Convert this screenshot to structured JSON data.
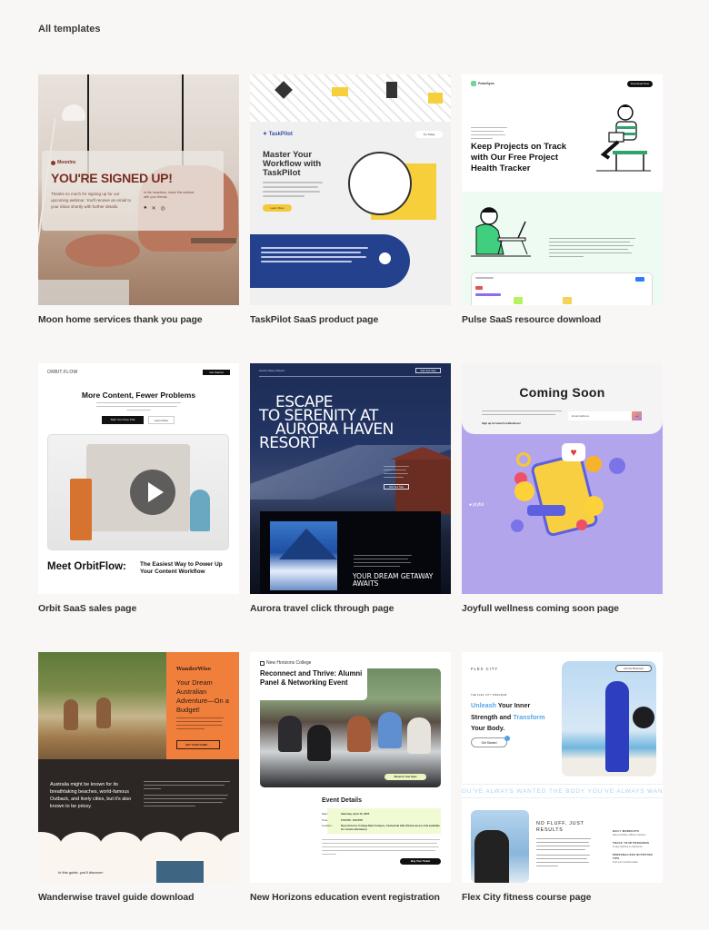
{
  "page": {
    "heading": "All templates"
  },
  "templates": [
    {
      "caption": "Moon home services thank you page",
      "preview": {
        "brand": "MoonInc",
        "headline": "YOU'RE SIGNED UP!",
        "body": "Thanks so much for signing up for our upcoming webinar. You'll receive an email to your inbox shortly with further details.",
        "share_text": "In the meantime, share this webinar with your friends.",
        "social_icons": [
          "facebook-icon",
          "x-icon",
          "instagram-icon"
        ],
        "accent_color": "#7a2e22"
      }
    },
    {
      "caption": "TaskPilot SaaS product page",
      "preview": {
        "brand": "TaskPilot",
        "nav_button": "Try Today",
        "headline": "Master Your Workflow with TaskPilot",
        "cta": "Learn More",
        "accent_color": "#f7cf3b",
        "band_color": "#24418e"
      }
    },
    {
      "caption": "Pulse SaaS resource download",
      "preview": {
        "brand": "PulseSync",
        "nav_button": "Download Now",
        "headline": "Keep Projects on Track with Our Free Project Health Tracker",
        "accent_color": "#6fd39b"
      }
    },
    {
      "caption": "Orbit SaaS sales page",
      "preview": {
        "brand": "ORBIT.FLOW",
        "nav_button": "Get Started",
        "headline": "More Content, Fewer Problems",
        "primary_cta": "Start Your Free Trial",
        "secondary_cta": "Learn More",
        "section_title": "Meet OrbitFlow:",
        "section_subtitle": "The Easiest Way to Power Up Your Content Workflow",
        "accent_color": "#d6742f"
      }
    },
    {
      "caption": "Aurora travel click through page",
      "preview": {
        "brand": "Aurora Haven Resort",
        "nav_button": "Visit Your Stay",
        "nav_button_note": "label is a best reading of blurred text",
        "headline_lines": [
          "ESCAPE",
          "TO SERENITY AT",
          "AURORA HAVEN",
          "RESORT"
        ],
        "secondary_headline": "YOUR DREAM GETAWAY AWAITS",
        "accent_color": "#1c2c55"
      }
    },
    {
      "caption": "Joyfull wellness coming soon page",
      "preview": {
        "brand": "joyful",
        "headline": "Coming Soon",
        "description": "An innovative new app that will improve your focus, reduce your stress, and help you live more joyfully.",
        "signup_label": "Sign up for launch notifications!",
        "email_placeholder": "Email address",
        "submit_icon": "arrow-right-icon",
        "accent_color": "#b3a5ec"
      }
    },
    {
      "caption": "Wanderwise travel guide download",
      "preview": {
        "brand": "WanderWise",
        "brand_note": "wordmark is script-styled; name inferred from caption",
        "headline": "Your Dream Australian Adventure—On a Budget!",
        "cta": "GET YOUR GUIDE →",
        "intro": "Australia might be known for its breathtaking beaches, world-famous Outback, and lively cities, but it's also known to be pricey.",
        "list_heading": "In this guide, you'll discover:",
        "accent_color": "#f07f3c"
      }
    },
    {
      "caption": "New Horizons education event registration",
      "preview": {
        "brand": "New Horizons College",
        "headline": "Reconnect and Thrive: Alumni Panel & Networking Event",
        "hero_cta": "Reserve Your Spot",
        "details_title": "Event Details",
        "details": [
          {
            "label": "Date:",
            "value": "Saturday, April 15, 2025"
          },
          {
            "label": "Time:",
            "value": "5:00 PM - 8:00 PM"
          },
          {
            "label": "Location:",
            "value": "New Horizons College Main Campus, Centennial Hall (Virtual access link available for remote attendees)"
          }
        ],
        "cta": "Buy Your Ticket",
        "accent_color": "#f0fbd4"
      }
    },
    {
      "caption": "Flex City fitness course page",
      "preview": {
        "brand": "FLEX CITY",
        "nav_button": "Join the Movement",
        "eyebrow": "THE FLEX CITY PROGRAM",
        "headline_parts": [
          {
            "text": "Unleash",
            "highlight": true
          },
          {
            "text": " Your Inner Strength and ",
            "highlight": false
          },
          {
            "text": "Transform",
            "highlight": true
          },
          {
            "text": " Your Body.",
            "highlight": false
          }
        ],
        "cta": "Get Started",
        "marquee": "OU'VE ALWAYS WANTED     THE BODY YOU'VE ALWAYS WANTED",
        "section_title": "NO FLUFF, JUST RESULTS",
        "features": [
          {
            "title": "DAILY WORKOUTS",
            "text": "Easy-to-follow, efficient routines"
          },
          {
            "title": "TRACK YOUR PROGRESS",
            "text": "In-app tracking & milestones"
          },
          {
            "title": "PERSONALIZED NUTRITION TIPS",
            "text": "Fuel your transformation"
          }
        ],
        "accent_color": "#57a7ea"
      }
    }
  ]
}
